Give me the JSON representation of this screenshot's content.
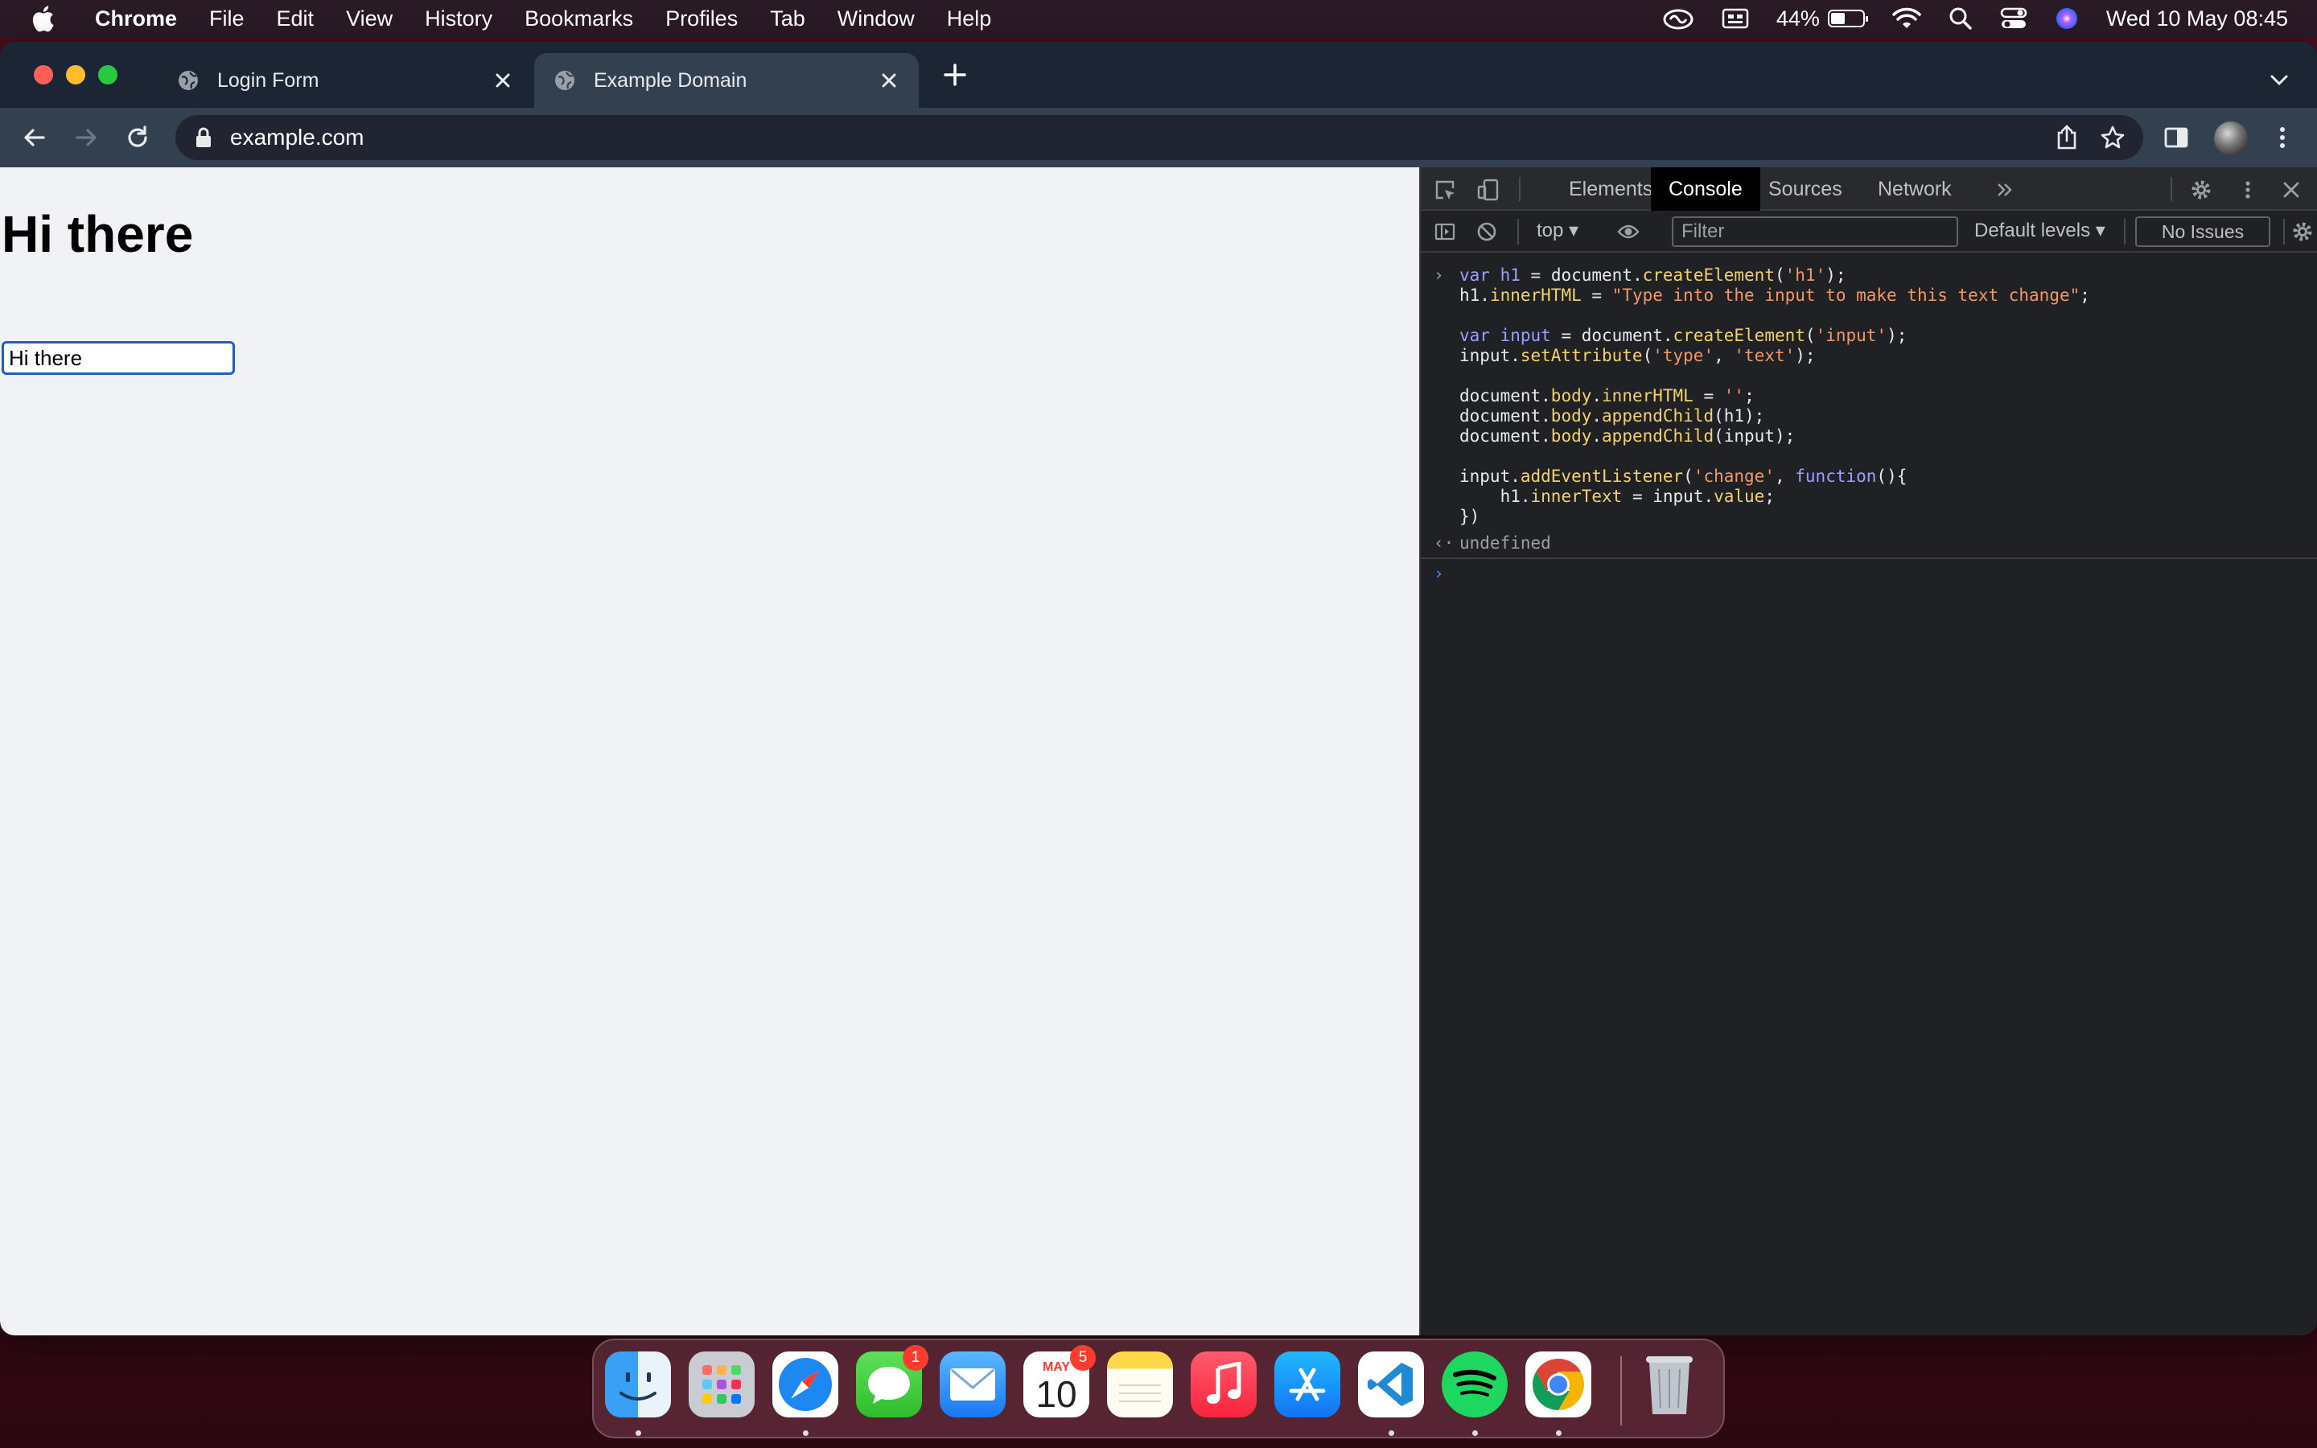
{
  "menubar": {
    "app_name": "Chrome",
    "items": [
      "File",
      "Edit",
      "View",
      "History",
      "Bookmarks",
      "Profiles",
      "Tab",
      "Window",
      "Help"
    ],
    "battery_percent": "44%",
    "battery_level": 0.44,
    "datetime": "Wed 10 May  08:45"
  },
  "tabs": [
    {
      "title": "Login Form",
      "active": false
    },
    {
      "title": "Example Domain",
      "active": true
    }
  ],
  "address_bar": {
    "url": "example.com"
  },
  "page": {
    "heading": "Hi there",
    "input_value": "Hi there"
  },
  "devtools": {
    "tabs": [
      "Elements",
      "Console",
      "Sources",
      "Network"
    ],
    "active_tab": "Console",
    "context": "top",
    "filter_placeholder": "Filter",
    "levels": "Default levels",
    "issues": "No Issues",
    "console_result": "undefined"
  },
  "dock": {
    "apps": [
      "Finder",
      "Launchpad",
      "Safari",
      "Messages",
      "Mail",
      "Calendar",
      "Notes",
      "Music",
      "App Store",
      "Visual Studio Code",
      "Spotify",
      "Google Chrome",
      "Trash"
    ],
    "messages_badge": "1",
    "calendar_badge": "5",
    "calendar_month": "MAY",
    "calendar_day": "10"
  },
  "colors": {
    "accent_blue": "#1a5fd0",
    "devtools_bg": "#202124",
    "page_bg": "#f1f2f6"
  }
}
